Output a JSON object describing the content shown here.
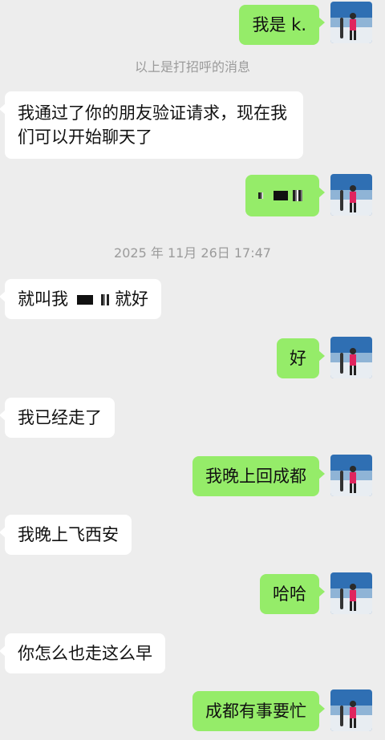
{
  "system": {
    "greeting_note": "以上是打招呼的消息",
    "timestamp": "2025 年 11月 26日 17:47"
  },
  "messages": [
    {
      "side": "out",
      "text": "我是 k."
    },
    {
      "side": "in",
      "text": "我通过了你的朋友验证请求，现在我们可以开始聊天了"
    },
    {
      "side": "out",
      "text": "",
      "redacted": true
    },
    {
      "side": "in",
      "text_prefix": "就叫我",
      "text_suffix": "就好",
      "redacted": true
    },
    {
      "side": "out",
      "text": "好"
    },
    {
      "side": "in",
      "text": "我已经走了"
    },
    {
      "side": "out",
      "text": "我晚上回成都"
    },
    {
      "side": "in",
      "text": "我晚上飞西安"
    },
    {
      "side": "out",
      "text": "哈哈"
    },
    {
      "side": "in",
      "text": "你怎么也走这么早"
    },
    {
      "side": "out",
      "text": "成都有事要忙"
    }
  ],
  "colors": {
    "background": "#ededed",
    "outgoing_bubble": "#95ec69",
    "incoming_bubble": "#ffffff",
    "system_text": "#9b9b9b"
  },
  "avatar": {
    "icon": "snowboarder-photo-icon"
  }
}
